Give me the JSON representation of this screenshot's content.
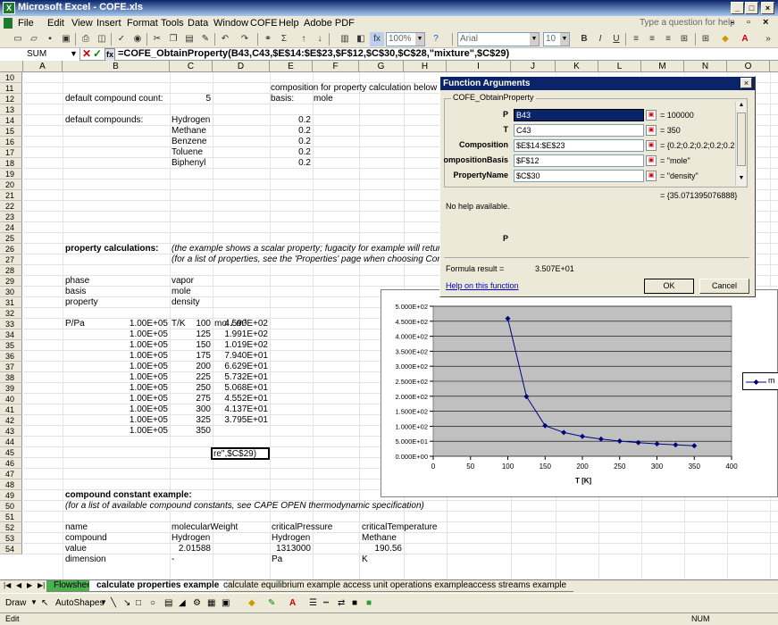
{
  "window": {
    "title": "Microsoft Excel - COFE.xls"
  },
  "menu": {
    "items": [
      "File",
      "Edit",
      "View",
      "Insert",
      "Format",
      "Tools",
      "Data",
      "Window",
      "COFE",
      "Help",
      "Adobe PDF"
    ],
    "ask": "Type a question for help"
  },
  "toolbar": {
    "zoom": "100%",
    "font": "Arial",
    "size": "10"
  },
  "formula": {
    "namebox": "SUM",
    "text": "=COFE_ObtainProperty(B43,C43,$E$14:$E$23,$F$12,$C$30,$C$28,\"mixture\",$C$29)"
  },
  "columns": [
    "A",
    "B",
    "C",
    "D",
    "E",
    "F",
    "G",
    "H",
    "I",
    "J",
    "K",
    "L",
    "M",
    "N",
    "O"
  ],
  "rows": [
    "10",
    "11",
    "12",
    "13",
    "14",
    "15",
    "16",
    "17",
    "18",
    "19",
    "20",
    "21",
    "22",
    "23",
    "24",
    "25",
    "26",
    "27",
    "28",
    "29",
    "30",
    "31",
    "32",
    "33",
    "34",
    "35",
    "36",
    "37",
    "38",
    "39",
    "40",
    "41",
    "42",
    "43",
    "44",
    "45",
    "46",
    "47",
    "48",
    "49",
    "50",
    "51",
    "52",
    "53",
    "54"
  ],
  "cells": {
    "e11": "composition for property calculation below",
    "b12": "default compound count:",
    "c12": "5",
    "e12": "basis:",
    "f12": "mole",
    "b14": "default compounds:",
    "compounds": [
      "Hydrogen",
      "Methane",
      "Benzene",
      "Toluene",
      "Biphenyl"
    ],
    "fractions": [
      "0.2",
      "0.2",
      "0.2",
      "0.2",
      "0.2"
    ],
    "b25": "property calculations:",
    "c25": "(the example shows a scalar property; fugacity for example will return",
    "c26": "(for a list of properties, see the 'Properties' page when choosing Conf",
    "b28": "phase",
    "c28": "vapor",
    "b29": "basis",
    "c29": "mole",
    "b30": "property",
    "c30": "density",
    "b32": "P/Pa",
    "c32": "T/K",
    "d32": "mol / m³",
    "pressure": [
      "1.00E+05",
      "1.00E+05",
      "1.00E+05",
      "1.00E+05",
      "1.00E+05",
      "1.00E+05",
      "1.00E+05",
      "1.00E+05",
      "1.00E+05",
      "1.00E+05",
      "1.00E+05"
    ],
    "temps": [
      "100",
      "125",
      "150",
      "175",
      "200",
      "225",
      "250",
      "275",
      "300",
      "325",
      "350"
    ],
    "densities": [
      "4.590E+02",
      "1.991E+02",
      "1.019E+02",
      "7.940E+01",
      "6.629E+01",
      "5.732E+01",
      "5.068E+01",
      "4.552E+01",
      "4.137E+01",
      "3.795E+01"
    ],
    "d43": "re\",$C$29)",
    "b47": "compound constant example:",
    "b48": "(for a list of available compound constants, see CAPE OPEN thermodynamic specification)",
    "b50": "name",
    "c50": "molecularWeight",
    "e50": "criticalPressure",
    "g50": "criticalTemperature",
    "b51": "compound",
    "c51": "Hydrogen",
    "e51": "Hydrogen",
    "g51": "Methane",
    "b52": "value",
    "c52": "2.01588",
    "e52": "1313000",
    "g52": "190.56",
    "b53": "dimension",
    "c53": "-",
    "e53": "Pa",
    "g53": "K"
  },
  "dialog": {
    "title": "Function Arguments",
    "group": "COFE_ObtainProperty",
    "args": [
      {
        "label": "P",
        "value": "B43",
        "result": "= 100000"
      },
      {
        "label": "T",
        "value": "C43",
        "result": "= 350"
      },
      {
        "label": "Composition",
        "value": "$E$14:$E$23",
        "result": "= {0.2;0.2;0.2;0.2;0.2"
      },
      {
        "label": "ompositionBasis",
        "value": "$F$12",
        "result": "= \"mole\""
      },
      {
        "label": "PropertyName",
        "value": "$C$30",
        "result": "= \"density\""
      }
    ],
    "total": "= {35.071395076888}",
    "nohelp": "No help available.",
    "param": "P",
    "formula_label": "Formula result =",
    "formula_value": "3.507E+01",
    "help_link": "Help on this function",
    "ok": "OK",
    "cancel": "Cancel"
  },
  "chart_data": {
    "type": "line",
    "x": [
      100,
      125,
      150,
      175,
      200,
      225,
      250,
      275,
      300,
      325,
      350
    ],
    "series": [
      {
        "name": "m",
        "values": [
          459.0,
          199.1,
          101.9,
          79.4,
          66.29,
          57.32,
          50.68,
          45.52,
          41.37,
          37.95,
          35.07
        ]
      }
    ],
    "xlabel": "T [K]",
    "ylabel": "",
    "xlim": [
      0,
      400
    ],
    "ylim": [
      0,
      500
    ],
    "xticks": [
      "0",
      "50",
      "100",
      "150",
      "200",
      "250",
      "300",
      "350",
      "400"
    ],
    "yticks": [
      "0.000E+00",
      "5.000E+01",
      "1.000E+02",
      "1.500E+02",
      "2.000E+02",
      "2.500E+02",
      "3.000E+02",
      "3.500E+02",
      "4.000E+02",
      "4.500E+02",
      "5.000E+02"
    ],
    "grid": true,
    "legend": "right",
    "plot_bg": "#c0c0c0",
    "line_color": "#000080"
  },
  "sheets": [
    "Flowsheet",
    "calculate properties example",
    "calculate equilibrium example",
    "access unit operations example",
    "access streams example"
  ],
  "drawbar": {
    "draw": "Draw",
    "autoshapes": "AutoShapes"
  },
  "status": {
    "mode": "Edit",
    "num": "NUM"
  }
}
